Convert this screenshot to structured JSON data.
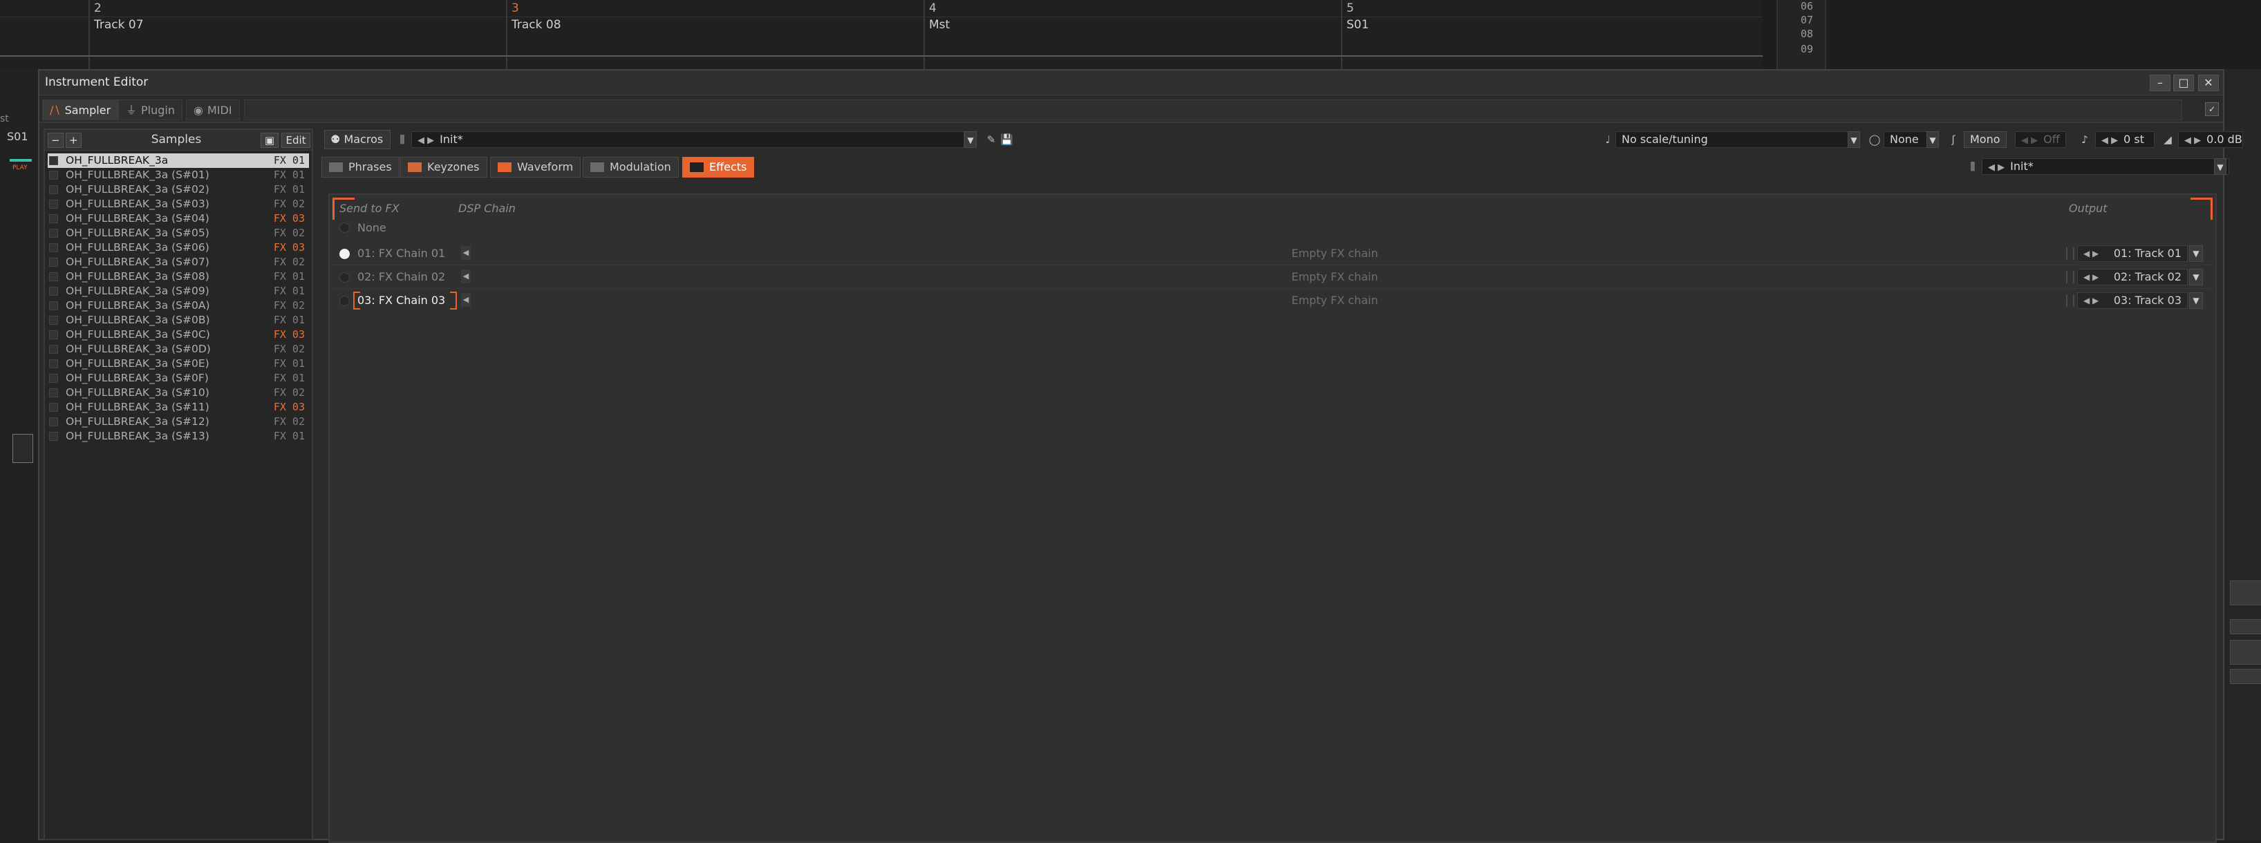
{
  "background": {
    "tracks": [
      {
        "num": "2",
        "name": "Track 07",
        "num_color": "#bdbdbd"
      },
      {
        "num": "3",
        "name": "Track 08",
        "num_color": "#e8713a"
      },
      {
        "num": "4",
        "name": "Mst",
        "num_color": "#bdbdbd"
      },
      {
        "num": "5",
        "name": "S01",
        "num_color": "#bdbdbd"
      }
    ],
    "row_numbers": [
      "06",
      "07",
      "08",
      "09"
    ],
    "left_strip": {
      "label_top": "st",
      "label": "S01",
      "mini_labels": [
        "PLAY"
      ]
    }
  },
  "window": {
    "title": "Instrument Editor",
    "buttons": {
      "minimize": "–",
      "maximize": "□",
      "close": "✕"
    }
  },
  "tabs": [
    {
      "label": "Sampler",
      "icon": "waveform-icon",
      "active": true
    },
    {
      "label": "Plugin",
      "icon": "plug-icon",
      "active": false
    },
    {
      "label": "MIDI",
      "icon": "midi-icon",
      "active": false
    }
  ],
  "samples_panel": {
    "title": "Samples",
    "minus": "−",
    "plus": "+",
    "edit_label": "Edit",
    "items": [
      {
        "name": "OH_FULLBREAK_3a",
        "fx": "FX 01",
        "hot": false,
        "selected": true
      },
      {
        "name": "OH_FULLBREAK_3a (S#01)",
        "fx": "FX 01",
        "hot": false
      },
      {
        "name": "OH_FULLBREAK_3a (S#02)",
        "fx": "FX 01",
        "hot": false
      },
      {
        "name": "OH_FULLBREAK_3a (S#03)",
        "fx": "FX 02",
        "hot": false
      },
      {
        "name": "OH_FULLBREAK_3a (S#04)",
        "fx": "FX 03",
        "hot": true
      },
      {
        "name": "OH_FULLBREAK_3a (S#05)",
        "fx": "FX 02",
        "hot": false
      },
      {
        "name": "OH_FULLBREAK_3a (S#06)",
        "fx": "FX 03",
        "hot": true
      },
      {
        "name": "OH_FULLBREAK_3a (S#07)",
        "fx": "FX 02",
        "hot": false
      },
      {
        "name": "OH_FULLBREAK_3a (S#08)",
        "fx": "FX 01",
        "hot": false
      },
      {
        "name": "OH_FULLBREAK_3a (S#09)",
        "fx": "FX 01",
        "hot": false
      },
      {
        "name": "OH_FULLBREAK_3a (S#0A)",
        "fx": "FX 02",
        "hot": false
      },
      {
        "name": "OH_FULLBREAK_3a (S#0B)",
        "fx": "FX 01",
        "hot": false
      },
      {
        "name": "OH_FULLBREAK_3a (S#0C)",
        "fx": "FX 03",
        "hot": true
      },
      {
        "name": "OH_FULLBREAK_3a (S#0D)",
        "fx": "FX 02",
        "hot": false
      },
      {
        "name": "OH_FULLBREAK_3a (S#0E)",
        "fx": "FX 01",
        "hot": false
      },
      {
        "name": "OH_FULLBREAK_3a (S#0F)",
        "fx": "FX 01",
        "hot": false
      },
      {
        "name": "OH_FULLBREAK_3a (S#10)",
        "fx": "FX 02",
        "hot": false
      },
      {
        "name": "OH_FULLBREAK_3a (S#11)",
        "fx": "FX 03",
        "hot": true
      },
      {
        "name": "OH_FULLBREAK_3a (S#12)",
        "fx": "FX 02",
        "hot": false
      },
      {
        "name": "OH_FULLBREAK_3a (S#13)",
        "fx": "FX 01",
        "hot": false
      }
    ]
  },
  "toolbar": {
    "macros_label": "Macros",
    "preset": "Init*",
    "scale": "No scale/tuning",
    "key": "None",
    "mono_label": "Mono",
    "glide": "Off",
    "transpose": "0 st",
    "volume": "0.0 dB"
  },
  "subtabs": [
    {
      "label": "Phrases",
      "icon": "phrases-icon",
      "active": false
    },
    {
      "label": "Keyzones",
      "icon": "keyzones-icon",
      "active": false
    },
    {
      "label": "Waveform",
      "icon": "waveform-icon",
      "active": false
    },
    {
      "label": "Modulation",
      "icon": "modulation-icon",
      "active": false
    },
    {
      "label": "Effects",
      "icon": "fx-icon",
      "active": true
    }
  ],
  "effects_preset": "Init*",
  "effects": {
    "headers": {
      "send": "Send to FX",
      "chain": "DSP Chain",
      "output": "Output"
    },
    "none_label": "None",
    "rows": [
      {
        "name": "01: FX Chain 01",
        "chain": "Empty FX chain",
        "output": "01: Track 01",
        "selected": true,
        "highlight": false
      },
      {
        "name": "02: FX Chain 02",
        "chain": "Empty FX chain",
        "output": "02: Track 02",
        "selected": false,
        "highlight": false
      },
      {
        "name": "03: FX Chain 03",
        "chain": "Empty FX chain",
        "output": "03: Track 03",
        "selected": false,
        "highlight": true
      }
    ]
  },
  "accent_color": "#e8642f"
}
